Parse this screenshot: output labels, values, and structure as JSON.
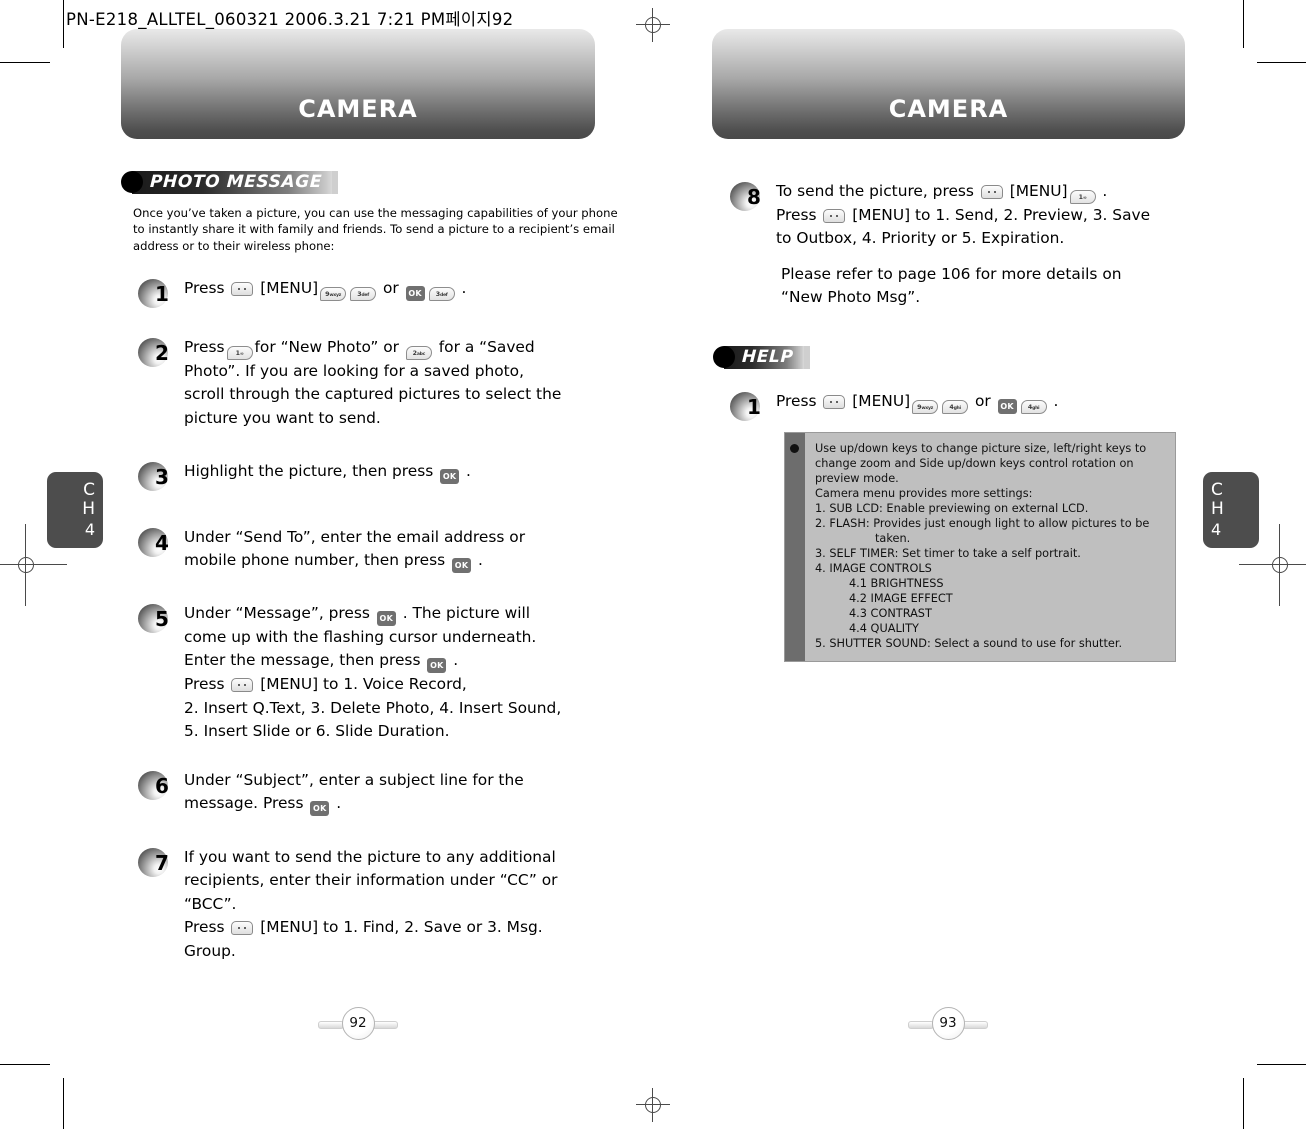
{
  "prepress": {
    "header": "PN-E218_ALLTEL_060321  2006.3.21 7:21 PM페이지92"
  },
  "left_page": {
    "banner_title": "CAMERA",
    "section_badge": "PHOTO MESSAGE",
    "intro": "Once you’ve taken a picture, you can use the messaging capabilities of your phone to instantly share it with family and friends. To send a picture to a recipient’s email address or to their wireless phone:",
    "chapter_tab": {
      "letters": "C\nH",
      "number": "4"
    },
    "page_number": "92",
    "steps": [
      {
        "number": "1",
        "lines": [
          [
            {
              "t": "text",
              "v": "Press "
            },
            {
              "t": "key-menu"
            },
            {
              "t": "text",
              "v": " [MENU]"
            },
            {
              "t": "key-num",
              "v": "9",
              "sub": "wxyz"
            },
            {
              "t": "key-num",
              "v": "3",
              "sub": "def"
            },
            {
              "t": "text",
              "v": " or "
            },
            {
              "t": "key-ok",
              "v": "OK"
            },
            {
              "t": "key-num",
              "v": "3",
              "sub": "def"
            },
            {
              "t": "text",
              "v": " ."
            }
          ]
        ]
      },
      {
        "number": "2",
        "lines": [
          [
            {
              "t": "text",
              "v": "Press"
            },
            {
              "t": "key-num",
              "v": "1",
              "sub": "∞"
            },
            {
              "t": "text",
              "v": "for “New Photo” or "
            },
            {
              "t": "key-num",
              "v": "2",
              "sub": "abc"
            },
            {
              "t": "text",
              "v": " for a “Saved"
            }
          ],
          [
            {
              "t": "text",
              "v": "Photo”.   If you are looking for a saved photo,"
            }
          ],
          [
            {
              "t": "text",
              "v": "scroll through the captured pictures to select the"
            }
          ],
          [
            {
              "t": "text",
              "v": "picture you want to send."
            }
          ]
        ]
      },
      {
        "number": "3",
        "lines": [
          [
            {
              "t": "text",
              "v": "Highlight the picture, then press "
            },
            {
              "t": "key-ok",
              "v": "OK"
            },
            {
              "t": "text",
              "v": " ."
            }
          ]
        ]
      },
      {
        "number": "4",
        "lines": [
          [
            {
              "t": "text",
              "v": "Under “Send To”, enter the email address or"
            }
          ],
          [
            {
              "t": "text",
              "v": "mobile phone number, then press "
            },
            {
              "t": "key-ok",
              "v": "OK"
            },
            {
              "t": "text",
              "v": "  ."
            }
          ]
        ]
      },
      {
        "number": "5",
        "lines": [
          [
            {
              "t": "text",
              "v": "Under “Message”, press "
            },
            {
              "t": "key-ok",
              "v": "OK"
            },
            {
              "t": "text",
              "v": " . The picture will"
            }
          ],
          [
            {
              "t": "text",
              "v": "come up with the flashing cursor underneath."
            }
          ],
          [
            {
              "t": "text",
              "v": "Enter the message, then press "
            },
            {
              "t": "key-ok",
              "v": "OK"
            },
            {
              "t": "text",
              "v": "  ."
            }
          ],
          [
            {
              "t": "text",
              "v": "Press "
            },
            {
              "t": "key-menu"
            },
            {
              "t": "text",
              "v": " [MENU] to 1. Voice Record,"
            }
          ],
          [
            {
              "t": "text",
              "v": "2. Insert Q.Text, 3. Delete Photo, 4. Insert Sound,"
            }
          ],
          [
            {
              "t": "text",
              "v": "5. Insert Slide or 6. Slide Duration."
            }
          ]
        ]
      },
      {
        "number": "6",
        "lines": [
          [
            {
              "t": "text",
              "v": "Under “Subject”, enter a subject line for the"
            }
          ],
          [
            {
              "t": "text",
              "v": "message. Press "
            },
            {
              "t": "key-ok",
              "v": "OK"
            },
            {
              "t": "text",
              "v": "  ."
            }
          ]
        ]
      },
      {
        "number": "7",
        "lines": [
          [
            {
              "t": "text",
              "v": "If you want to send the picture to any additional"
            }
          ],
          [
            {
              "t": "text",
              "v": "recipients, enter their information under “CC” or"
            }
          ],
          [
            {
              "t": "text",
              "v": "“BCC”."
            }
          ],
          [
            {
              "t": "text",
              "v": "Press  "
            },
            {
              "t": "key-menu"
            },
            {
              "t": "text",
              "v": " [MENU] to 1. Find, 2. Save or 3. Msg."
            }
          ],
          [
            {
              "t": "text",
              "v": "Group."
            }
          ]
        ]
      }
    ]
  },
  "right_page": {
    "banner_title": "CAMERA",
    "section_badge": "HELP",
    "chapter_tab": {
      "letters": "C\nH",
      "number": "4"
    },
    "page_number": "93",
    "steps": [
      {
        "number": "8",
        "lines": [
          [
            {
              "t": "text",
              "v": "To send the picture, press "
            },
            {
              "t": "key-menu"
            },
            {
              "t": "text",
              "v": " [MENU]"
            },
            {
              "t": "key-num",
              "v": "1",
              "sub": "∞"
            },
            {
              "t": "text",
              "v": " ."
            }
          ],
          [
            {
              "t": "text",
              "v": "Press "
            },
            {
              "t": "key-menu"
            },
            {
              "t": "text",
              "v": "  [MENU] to 1. Send, 2. Preview, 3. Save"
            }
          ],
          [
            {
              "t": "text",
              "v": "to Outbox, 4. Priority or 5. Expiration."
            }
          ]
        ]
      }
    ],
    "note": [
      "Please refer to page 106 for more details on",
      "“New Photo Msg”."
    ],
    "help_steps": [
      {
        "number": "1",
        "lines": [
          [
            {
              "t": "text",
              "v": "Press "
            },
            {
              "t": "key-menu"
            },
            {
              "t": "text",
              "v": " [MENU]"
            },
            {
              "t": "key-num",
              "v": "9",
              "sub": "wxyz"
            },
            {
              "t": "key-num",
              "v": "4",
              "sub": "ghi"
            },
            {
              "t": "text",
              "v": " or "
            },
            {
              "t": "key-ok",
              "v": "OK"
            },
            {
              "t": "key-num",
              "v": "4",
              "sub": "ghi"
            },
            {
              "t": "text",
              "v": " ."
            }
          ]
        ]
      }
    ],
    "help_box": [
      {
        "indent": 0,
        "text": "Use up/down keys to change picture size, left/right keys to"
      },
      {
        "indent": 0,
        "text": "change zoom and Side up/down keys control rotation on"
      },
      {
        "indent": 0,
        "text": "preview mode."
      },
      {
        "indent": 0,
        "text": "Camera menu provides more settings:"
      },
      {
        "indent": 0,
        "text": "1. SUB LCD: Enable previewing on external LCD."
      },
      {
        "indent": 0,
        "text": "2. FLASH: Provides just enough light to allow pictures to be"
      },
      {
        "indent": 2,
        "text": "taken."
      },
      {
        "indent": 0,
        "text": "3. SELF TIMER: Set timer to take a self portrait."
      },
      {
        "indent": 0,
        "text": "4. IMAGE CONTROLS"
      },
      {
        "indent": 1,
        "text": "4.1 BRIGHTNESS"
      },
      {
        "indent": 1,
        "text": "4.2 IMAGE EFFECT"
      },
      {
        "indent": 1,
        "text": "4.3 CONTRAST"
      },
      {
        "indent": 1,
        "text": "4.4 QUALITY"
      },
      {
        "indent": 0,
        "text": "5. SHUTTER SOUND: Select a sound to use for shutter."
      }
    ]
  },
  "colors": {
    "banner_dark": "#494949",
    "tab_gray": "#4d4d4d",
    "helpbox_bg": "#bfbfbf",
    "helpbox_rail": "#6d6d6d"
  }
}
